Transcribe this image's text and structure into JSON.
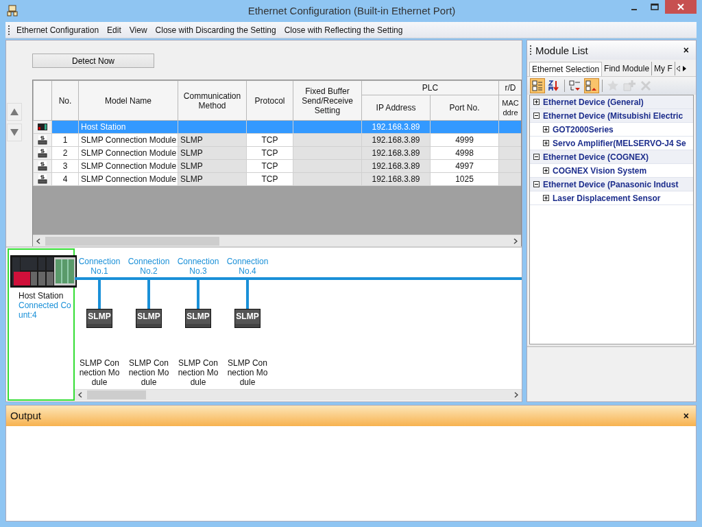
{
  "window": {
    "title": "Ethernet Configuration (Built-in Ethernet Port)"
  },
  "menu": [
    "Ethernet Configuration",
    "Edit",
    "View",
    "Close with Discarding the Setting",
    "Close with Reflecting the Setting"
  ],
  "detect_button": "Detect Now",
  "table": {
    "columns": [
      "No.",
      "Model Name",
      "Communication Method",
      "Protocol",
      "Fixed Buffer Send/Receive Setting"
    ],
    "groups": [
      {
        "label": "PLC",
        "columns": [
          "IP Address",
          "Port No."
        ]
      },
      {
        "label": "r/D",
        "columns": [
          "MAC ddre"
        ]
      }
    ],
    "rows": [
      {
        "kind": "host",
        "selected": true,
        "model": "Host Station",
        "ip": "192.168.3.89"
      },
      {
        "kind": "slmp",
        "selected": false,
        "no": "1",
        "model": "SLMP Connection Module",
        "method": "SLMP",
        "protocol": "TCP",
        "ip": "192.168.3.89",
        "port": "4999"
      },
      {
        "kind": "slmp",
        "selected": false,
        "no": "2",
        "model": "SLMP Connection Module",
        "method": "SLMP",
        "protocol": "TCP",
        "ip": "192.168.3.89",
        "port": "4998"
      },
      {
        "kind": "slmp",
        "selected": false,
        "no": "3",
        "model": "SLMP Connection Module",
        "method": "SLMP",
        "protocol": "TCP",
        "ip": "192.168.3.89",
        "port": "4997"
      },
      {
        "kind": "slmp",
        "selected": false,
        "no": "4",
        "model": "SLMP Connection Module",
        "method": "SLMP",
        "protocol": "TCP",
        "ip": "192.168.3.89",
        "port": "1025"
      }
    ]
  },
  "diagram": {
    "host": {
      "name": "Host Station",
      "count": "Connected Count:4",
      "selected": true
    },
    "connections": [
      {
        "label": "Connection No.1",
        "module": "SLMP",
        "name": "SLMP Connection Module"
      },
      {
        "label": "Connection No.2",
        "module": "SLMP",
        "name": "SLMP Connection Module"
      },
      {
        "label": "Connection No.3",
        "module": "SLMP",
        "name": "SLMP Connection Module"
      },
      {
        "label": "Connection No.4",
        "module": "SLMP",
        "name": "SLMP Connection Module"
      }
    ]
  },
  "module_list": {
    "title": "Module List",
    "close": "×",
    "tabs": [
      {
        "label": "Ethernet Selection",
        "selected": true
      },
      {
        "label": "Find Module",
        "selected": false
      },
      {
        "label": "My F",
        "selected": false
      }
    ],
    "toolbar": [
      {
        "kind": "category",
        "on": true,
        "disabled": false
      },
      {
        "kind": "sort",
        "on": false,
        "disabled": false
      },
      {
        "kind": "collapse",
        "on": false,
        "disabled": false
      },
      {
        "kind": "expand",
        "on": true,
        "disabled": false
      },
      {
        "kind": "star",
        "on": false,
        "disabled": true
      },
      {
        "kind": "add",
        "on": false,
        "disabled": true
      },
      {
        "kind": "delete",
        "on": false,
        "disabled": true
      }
    ],
    "tree": [
      {
        "label": "Ethernet Device (General)",
        "expanded": false
      },
      {
        "label": "Ethernet Device (Mitsubishi Electric",
        "expanded": true,
        "children": [
          {
            "label": "GOT2000Series",
            "expanded": false
          },
          {
            "label": "Servo Amplifier(MELSERVO-J4 Se",
            "expanded": false
          }
        ]
      },
      {
        "label": "Ethernet Device (COGNEX)",
        "expanded": true,
        "children": [
          {
            "label": "COGNEX Vision System",
            "expanded": false
          }
        ]
      },
      {
        "label": "Ethernet Device (Panasonic Indust",
        "expanded": true,
        "children": [
          {
            "label": "Laser Displacement Sensor",
            "expanded": false
          }
        ]
      }
    ]
  },
  "output": {
    "title": "Output",
    "close": "×"
  }
}
